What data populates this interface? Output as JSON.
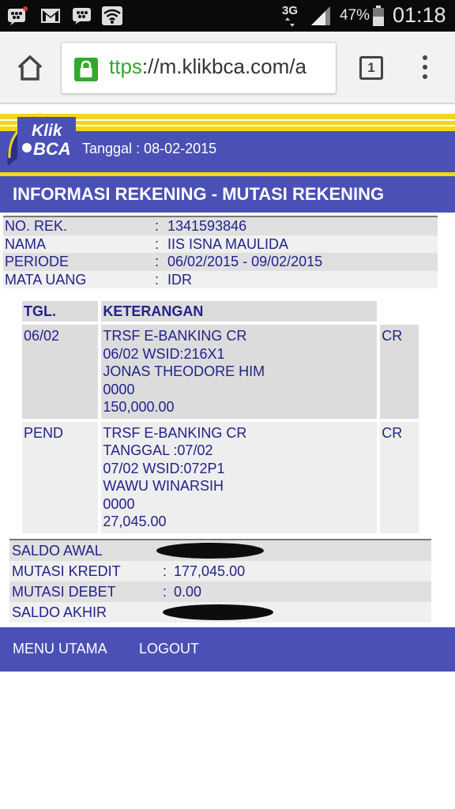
{
  "status_bar": {
    "network": "3G",
    "battery": "47%",
    "time": "01:18"
  },
  "browser": {
    "url_scheme": "ttps",
    "url_rest": "://m.klikbca.com/a",
    "tab_count": "1"
  },
  "header": {
    "logo_top": "Klik",
    "logo_bottom": "BCA",
    "date_text": "Tanggal : 08-02-2015"
  },
  "page_title": "INFORMASI REKENING - MUTASI REKENING",
  "account": [
    {
      "label": "NO. REK.",
      "value": "1341593846"
    },
    {
      "label": "NAMA",
      "value": "IIS ISNA MAULIDA"
    },
    {
      "label": "PERIODE",
      "value": "06/02/2015 - 09/02/2015"
    },
    {
      "label": "MATA UANG",
      "value": "IDR"
    }
  ],
  "transactions": {
    "headers": [
      "TGL.",
      "KETERANGAN"
    ],
    "rows": [
      {
        "date": "06/02",
        "lines": [
          "TRSF E-BANKING CR",
          "06/02 WSID:216X1",
          "JONAS THEODORE HIM",
          "0000",
          "150,000.00"
        ],
        "type": "CR"
      },
      {
        "date": "PEND",
        "lines": [
          "TRSF E-BANKING CR",
          "TANGGAL :07/02",
          "07/02 WSID:072P1",
          "WAWU WINARSIH",
          "0000",
          "27,045.00"
        ],
        "type": "CR"
      }
    ]
  },
  "summary": [
    {
      "label": "SALDO AWAL",
      "value": ""
    },
    {
      "label": "MUTASI KREDIT",
      "value": "177,045.00"
    },
    {
      "label": "MUTASI DEBET",
      "value": "0.00"
    },
    {
      "label": "SALDO AKHIR",
      "value": ""
    }
  ],
  "footer": {
    "menu_label": "MENU UTAMA",
    "logout_label": "LOGOUT"
  },
  "colors": {
    "brand_blue": "#4a50b5",
    "brand_yellow": "#f3d61a",
    "text_blue": "#22228a",
    "lock_green": "#34a82e"
  }
}
